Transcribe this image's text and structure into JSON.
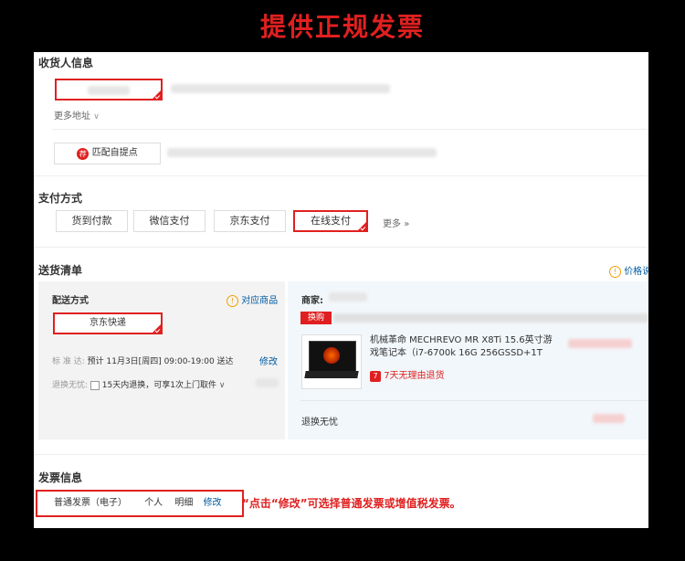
{
  "banner": {
    "title": "提供正规发票"
  },
  "receiver": {
    "section_title": "收货人信息",
    "more_address": "更多地址",
    "match_pickup": "匹配自提点",
    "pickup_badge": "荐"
  },
  "payment": {
    "section_title": "支付方式",
    "options": [
      "货到付款",
      "微信支付",
      "京东支付",
      "在线支付"
    ],
    "more": "更多"
  },
  "delivery": {
    "section_title": "送货清单",
    "price_note": "价格说",
    "method_title": "配送方式",
    "match_products": "对应商品",
    "method_value": "京东快递",
    "standard_label": "标 准 达:",
    "standard_value": "预计 11月3日[周四] 09:00-19:00 送达",
    "modify": "修改",
    "return_label": "退换无忧:",
    "return_value": "15天内退换，可享1次上门取件",
    "merchant_label": "商家:",
    "swap_badge": "换购",
    "product_name_1": "机械革命 MECHREVO MR X8Ti 15.6英寸游",
    "product_name_2": "戏笔记本（i7-6700k 16G 256GSSD+1T",
    "seven_day_badge": "7",
    "seven_day_text": "7天无理由退货",
    "return_worry": "退换无忧"
  },
  "invoice": {
    "section_title": "发票信息",
    "type": "普通发票（电子）",
    "personal": "个人",
    "detail": "明细",
    "modify": "修改",
    "hint": "“点击“修改”可选择普通发票或增值税发票。"
  }
}
